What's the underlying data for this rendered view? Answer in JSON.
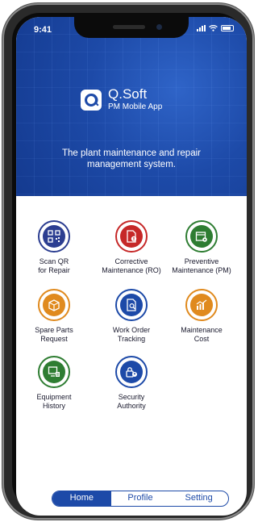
{
  "status_bar": {
    "time": "9:41"
  },
  "header": {
    "brand": "Q.Soft",
    "app_name": "PM Mobile App",
    "tagline_1": "The plant maintenance and repair",
    "tagline_2": "management system."
  },
  "menu": [
    {
      "line1": "Scan QR",
      "line2": "for Repair",
      "icon": "qr-code-icon",
      "color": "#2c3e91"
    },
    {
      "line1": "Corrective",
      "line2": "Maintenance (RO)",
      "icon": "document-alert-icon",
      "color": "#c62828"
    },
    {
      "line1": "Preventive",
      "line2": "Maintenance (PM)",
      "icon": "calendar-gear-icon",
      "color": "#2e7d32"
    },
    {
      "line1": "Spare Parts",
      "line2": "Request",
      "icon": "box-icon",
      "color": "#e08a1e"
    },
    {
      "line1": "Work Order",
      "line2": "Tracking",
      "icon": "document-search-icon",
      "color": "#1d4aa8"
    },
    {
      "line1": "Maintenance",
      "line2": "Cost",
      "icon": "chart-coins-icon",
      "color": "#e08a1e"
    },
    {
      "line1": "Equipment",
      "line2": "History",
      "icon": "monitor-history-icon",
      "color": "#2e7d32"
    },
    {
      "line1": "Security",
      "line2": "Authority",
      "icon": "lock-user-icon",
      "color": "#1d4aa8"
    }
  ],
  "tabs": {
    "home": "Home",
    "profile": "Profile",
    "setting": "Setting"
  }
}
